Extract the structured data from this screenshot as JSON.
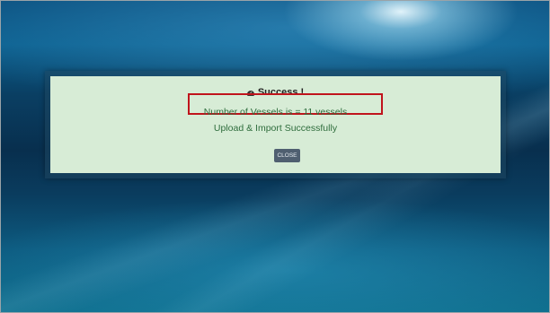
{
  "dialog": {
    "title": "Success !",
    "message": "Number of Vessels is = 11 vessels",
    "detail": "Upload & Import Successfully",
    "close_label": "CLOSE",
    "icon": "check-circle-icon"
  },
  "colors": {
    "dialog_background": "#d7ecd6",
    "message_text": "#2f6d3d",
    "highlight_box": "#c0141c",
    "close_button": "#4f5f70"
  }
}
